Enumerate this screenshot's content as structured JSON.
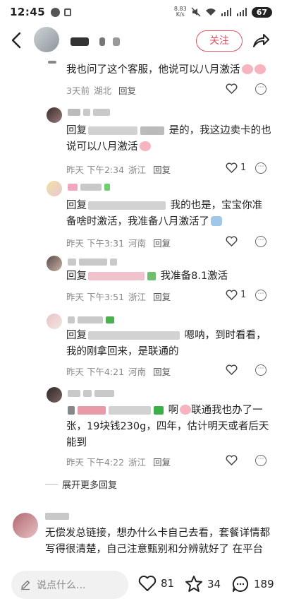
{
  "status_bar": {
    "time": "12:45",
    "net_speed_value": "8.83",
    "net_speed_unit": "K/s",
    "battery": "67"
  },
  "header": {
    "follow_label": "关注"
  },
  "comments": [
    {
      "text": "我也问了这个客服，他说可以八月激活",
      "time": "3天前",
      "location": "湖北",
      "reply_label": "回复",
      "likes": ""
    },
    {
      "prefix": "回复",
      "text": "是的，我这边卖卡的也说可以八月激活",
      "time": "昨天 下午2:34",
      "location": "浙江",
      "reply_label": "回复",
      "likes": "1"
    },
    {
      "prefix": "回复",
      "text": "我的也是，宝宝你准备啥时激活，我准备八月激活了",
      "time": "昨天 下午3:31",
      "location": "河南",
      "reply_label": "回复",
      "likes": ""
    },
    {
      "prefix": "回复",
      "text": "我准备8.1激活",
      "time": "昨天 下午3:51",
      "location": "浙江",
      "reply_label": "回复",
      "likes": "1"
    },
    {
      "prefix": "回复",
      "text": "嗯呐，到时看看，我的刚拿回来，是联通的",
      "time": "昨天 下午4:21",
      "location": "河南",
      "reply_label": "回复",
      "likes": ""
    },
    {
      "text_a": "啊",
      "text_b": "联通我也办了一张，19块钱230g，四年，估计明天或者后天能到",
      "time": "昨天 下午4:22",
      "location": "浙江",
      "reply_label": "回复",
      "likes": ""
    }
  ],
  "expand_label": "展开更多回复",
  "main_comment": {
    "text": "无偿发总链接，想办什么卡自己去看，套餐详情都写得很清楚，自己注意甄别和分辨就好了 在平台自己办理就行"
  },
  "bottom_bar": {
    "input_placeholder": "说点什么...",
    "likes": "81",
    "favorites": "34",
    "comments": "189"
  },
  "colors": {
    "accent": "#e05260",
    "meta_text": "#888888"
  }
}
